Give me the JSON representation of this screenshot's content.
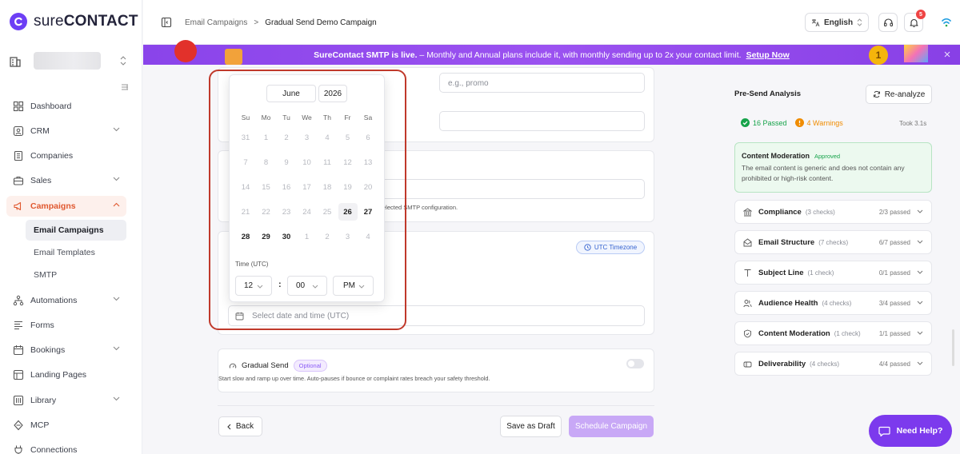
{
  "app": {
    "logo_text_light": "sure",
    "logo_text_bold": "CONTACT",
    "brand_color": "#6d3ff5"
  },
  "sidebar": {
    "items": [
      {
        "label": "Dashboard"
      },
      {
        "label": "CRM"
      },
      {
        "label": "Companies"
      },
      {
        "label": "Sales"
      },
      {
        "label": "Campaigns"
      },
      {
        "label": "Automations"
      },
      {
        "label": "Forms"
      },
      {
        "label": "Bookings"
      },
      {
        "label": "Landing Pages"
      },
      {
        "label": "Library"
      },
      {
        "label": "MCP"
      },
      {
        "label": "Connections"
      }
    ],
    "campaign_subitems": [
      {
        "label": "Email Campaigns"
      },
      {
        "label": "Email Templates"
      },
      {
        "label": "SMTP"
      }
    ]
  },
  "topbar": {
    "breadcrumb_parent": "Email Campaigns",
    "breadcrumb_separator": ">",
    "breadcrumb_current": "Gradual Send Demo Campaign",
    "language": "English",
    "notification_count": "5"
  },
  "banner": {
    "lead": "SureContact SMTP is live.",
    "text": " – Monthly and Annual plans include it, with monthly sending up to 2x your contact limit.",
    "link": "Setup Now",
    "badge": "1"
  },
  "form": {
    "tag_placeholder": "e.g., promo",
    "smtp_note": "elected SMTP configuration.",
    "timezone_badge": "UTC Timezone",
    "datetime_placeholder": "Select date and time (UTC)"
  },
  "calendar": {
    "month": "June",
    "year": "2026",
    "weekdays": [
      "Su",
      "Mo",
      "Tu",
      "We",
      "Th",
      "Fr",
      "Sa"
    ],
    "weeks": [
      [
        "31",
        "1",
        "2",
        "3",
        "4",
        "5",
        "6"
      ],
      [
        "7",
        "8",
        "9",
        "10",
        "11",
        "12",
        "13"
      ],
      [
        "14",
        "15",
        "16",
        "17",
        "18",
        "19",
        "20"
      ],
      [
        "21",
        "22",
        "23",
        "24",
        "25",
        "26",
        "27"
      ],
      [
        "28",
        "29",
        "30",
        "1",
        "2",
        "3",
        "4"
      ]
    ],
    "time_label": "Time (UTC)",
    "hour": "12",
    "separator": ":",
    "minute": "00",
    "ampm": "PM"
  },
  "gradual_send": {
    "title": "Gradual Send",
    "badge": "Optional",
    "description": "Start slow and ramp up over time. Auto-pauses if bounce or complaint rates breach your safety threshold.",
    "enabled": false
  },
  "footer": {
    "back": "Back",
    "save_draft": "Save as Draft",
    "schedule": "Schedule Campaign"
  },
  "analysis": {
    "title": "Pre-Send Analysis",
    "reanalyze": "Re-analyze",
    "passed": "16 Passed",
    "warnings": "4 Warnings",
    "took": "Took 3.1s",
    "moderation_title": "Content Moderation",
    "moderation_status": "Approved",
    "moderation_text": "The email content is generic and does not contain any prohibited or high-risk content.",
    "checks": [
      {
        "name": "Compliance",
        "count": "(3 checks)",
        "result": "2/3 passed"
      },
      {
        "name": "Email Structure",
        "count": "(7 checks)",
        "result": "6/7 passed"
      },
      {
        "name": "Subject Line",
        "count": "(1 check)",
        "result": "0/1 passed"
      },
      {
        "name": "Audience Health",
        "count": "(4 checks)",
        "result": "3/4 passed"
      },
      {
        "name": "Content Moderation",
        "count": "(1 check)",
        "result": "1/1 passed"
      },
      {
        "name": "Deliverability",
        "count": "(4 checks)",
        "result": "4/4 passed"
      }
    ]
  },
  "help": {
    "label": "Need Help?"
  },
  "colors": {
    "accent": "#e0582f",
    "purple": "#7c3aed",
    "success": "#16a34a",
    "warning": "#f08c00",
    "annotation": "#c0392b"
  }
}
